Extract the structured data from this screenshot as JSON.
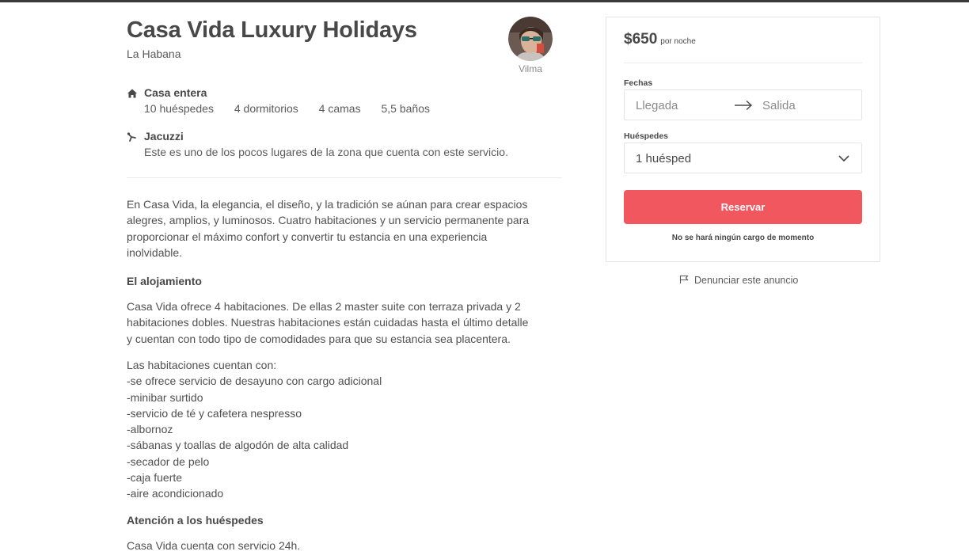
{
  "listing": {
    "title": "Casa Vida Luxury Holidays",
    "city": "La Habana"
  },
  "host": {
    "name": "Vilma"
  },
  "features": [
    {
      "icon": "home-icon",
      "title": "Casa entera",
      "details": [
        "10 huéspedes",
        "4 dormitorios",
        "4 camas",
        "5,5 baños"
      ]
    },
    {
      "icon": "sparkle-icon",
      "title": "Jacuzzi",
      "subtitle": "Este es uno de los pocos lugares de la zona que cuenta con este servicio."
    }
  ],
  "description": {
    "intro": [
      "En Casa Vida, la elegancia, el diseño, y la tradición se aúnan para crear espacios",
      "alegres, amplios, y luminosos. Cuatro habitaciones y un servicio permanente para",
      "proporcionar el máximo confort y convertir tu estancia en una experiencia",
      "inolvidable."
    ],
    "accommodation_heading": "El alojamiento",
    "accommodation_text": [
      "Casa Vida ofrece 4 habitaciones. De ellas 2 master suite con terraza privada y 2",
      "habitaciones dobles. Nuestras habitaciones están cuidadas hasta el último detalle",
      "y cuentan con todo tipo de comodidades para que su estancia sea placentera."
    ],
    "amenities_intro": "Las habitaciones cuentan con:",
    "amenities": [
      "-se ofrece servicio de desayuno con cargo adicional",
      "-minibar surtido",
      "-servicio de té y cafetera nespresso",
      "-albornoz",
      "-sábanas y toallas de algodón de alta calidad",
      "-secador de pelo",
      "-caja fuerte",
      "-aire acondicionado"
    ],
    "guest_heading": "Atención a los huéspedes",
    "guest_text": "Casa Vida cuenta con servicio 24h."
  },
  "booking": {
    "price": "$650",
    "price_unit": "por noche",
    "dates_label": "Fechas",
    "checkin_placeholder": "Llegada",
    "checkout_placeholder": "Salida",
    "guests_label": "Huéspedes",
    "guests_value": "1 huésped",
    "reserve_label": "Reservar",
    "no_charge_note": "No se hará ningún cargo de momento",
    "accent_color": "#f0575f"
  },
  "report_link": "Denunciar este anuncio"
}
